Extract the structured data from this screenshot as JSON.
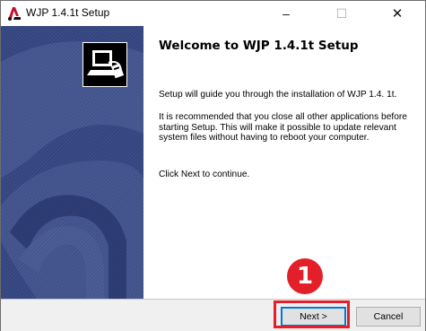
{
  "window": {
    "title": "WJP 1.4.1t Setup",
    "controls": {
      "minimize": "–",
      "maximize": "☐",
      "close": "✕"
    }
  },
  "content": {
    "heading": "Welcome to WJP 1.4.1t Setup",
    "paragraphs": [
      "Setup will guide you through the installation of WJP 1.4. 1t.",
      "It is recommended that you close all other applications before starting Setup. This will make it possible to update relevant system files without having to reboot your computer.",
      "Click Next to continue."
    ]
  },
  "buttons": {
    "next": "Next >",
    "cancel": "Cancel"
  },
  "annotation": {
    "step_number": "1",
    "color": "#e3202a"
  },
  "icons": {
    "title": "app-logo-icon",
    "installer": "installer-computer-icon"
  }
}
